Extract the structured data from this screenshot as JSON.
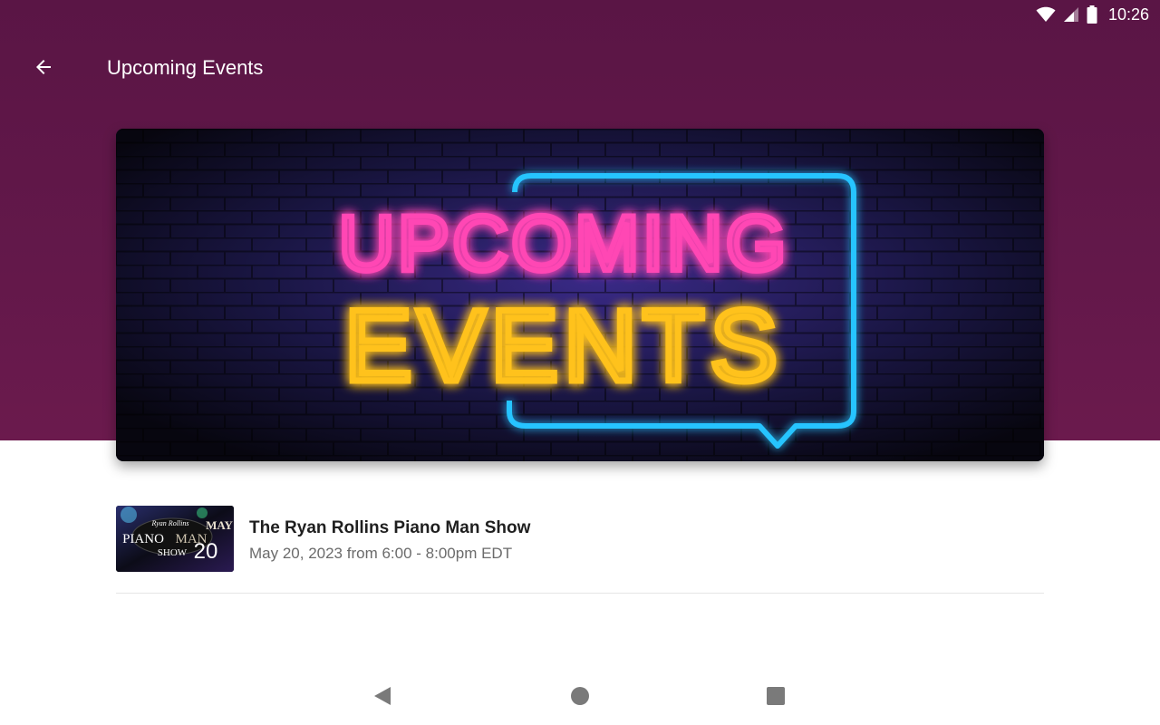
{
  "status_bar": {
    "time": "10:26",
    "icons": [
      "wifi-icon",
      "cell-signal-icon",
      "battery-icon"
    ]
  },
  "app_bar": {
    "title": "Upcoming Events",
    "back_icon": "arrow-back-icon"
  },
  "banner": {
    "line1": "UPCOMING",
    "line2": "EVENTS",
    "colors": {
      "line1": "#ff3aa8",
      "line2": "#ffc21a",
      "frame": "#22b8ff"
    }
  },
  "events": [
    {
      "title": "The Ryan Rollins Piano Man Show",
      "date": "May 20, 2023 from 6:00 - 8:00pm EDT",
      "thumb": {
        "line_top": "Ryan Rollins",
        "month": "MAY",
        "word1": "PIANO",
        "word2": "MAN",
        "word3": "SHOW",
        "day": "20"
      }
    }
  ],
  "nav_bar": {
    "icons": [
      "nav-back-icon",
      "nav-home-icon",
      "nav-recents-icon"
    ]
  },
  "colors": {
    "header": "#5e1647",
    "title_text": "#1f1f1f",
    "subtitle_text": "#6b6b6b"
  }
}
